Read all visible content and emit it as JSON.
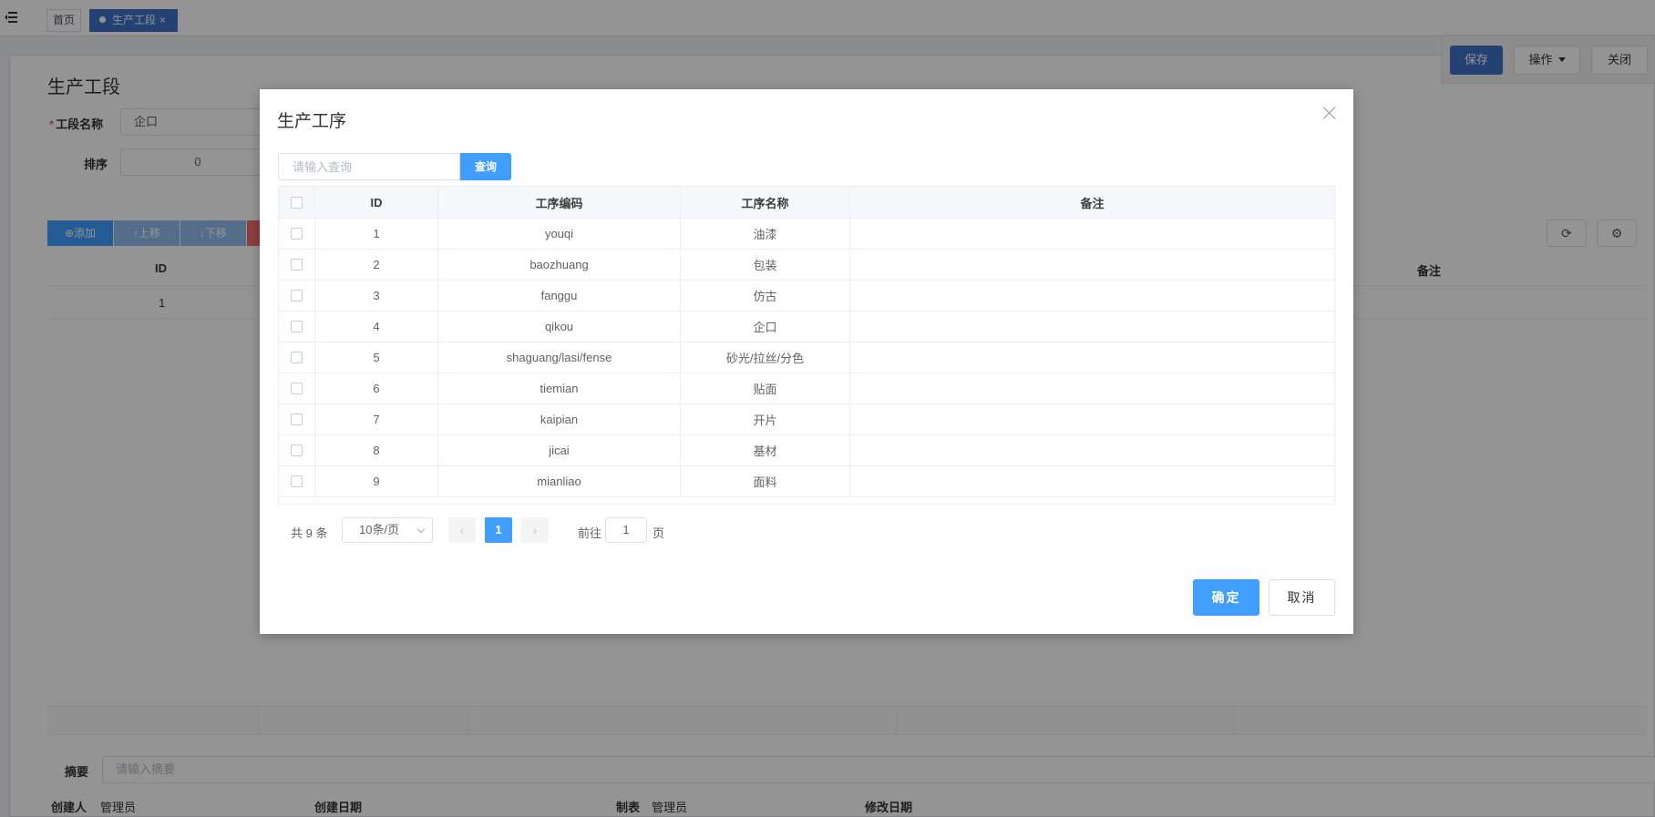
{
  "topbar": {
    "tabs": [
      {
        "label": "首页"
      },
      {
        "label": "生产工段",
        "close": "×"
      }
    ]
  },
  "page": {
    "title": "生产工段",
    "form": {
      "name_label": "工段名称",
      "name_value": "企口",
      "sort_label": "排序",
      "sort_value": "0"
    },
    "toolbar": {
      "add": "⊕添加",
      "up": "↑上移",
      "down": "↓下移"
    },
    "grid": {
      "col_id": "ID",
      "col_remark": "备注",
      "rows": [
        {
          "id": "1"
        }
      ]
    },
    "summary_label": "摘要",
    "summary_placeholder": "请输入摘要",
    "footer": {
      "creator_label": "创建人",
      "creator_value": "管理员",
      "created_label": "创建日期",
      "maker_label": "制表",
      "maker_value": "管理员",
      "modified_label": "修改日期"
    },
    "actions": {
      "save": "保存",
      "ops": "操作",
      "close": "关闭"
    }
  },
  "modal": {
    "title": "生产工序",
    "search_placeholder": "请输入查询",
    "search_button": "查询",
    "columns": {
      "id": "ID",
      "code": "工序编码",
      "name": "工序名称",
      "remark": "备注"
    },
    "rows": [
      {
        "id": "1",
        "code": "youqi",
        "name": "油漆",
        "remark": ""
      },
      {
        "id": "2",
        "code": "baozhuang",
        "name": "包装",
        "remark": ""
      },
      {
        "id": "3",
        "code": "fanggu",
        "name": "仿古",
        "remark": ""
      },
      {
        "id": "4",
        "code": "qikou",
        "name": "企口",
        "remark": ""
      },
      {
        "id": "5",
        "code": "shaguang/lasi/fense",
        "name": "砂光/拉丝/分色",
        "remark": ""
      },
      {
        "id": "6",
        "code": "tiemian",
        "name": "贴面",
        "remark": ""
      },
      {
        "id": "7",
        "code": "kaipian",
        "name": "开片",
        "remark": ""
      },
      {
        "id": "8",
        "code": "jicai",
        "name": "基材",
        "remark": ""
      },
      {
        "id": "9",
        "code": "mianliao",
        "name": "面料",
        "remark": ""
      }
    ],
    "pager": {
      "total": "共 9 条",
      "page_size": "10条/页",
      "prev": "‹",
      "current": "1",
      "next": "›",
      "goto_prefix": "前往",
      "goto_value": "1",
      "goto_suffix": "页"
    },
    "ok": "确定",
    "cancel": "取消"
  },
  "colors": {
    "primary": "#409eff",
    "tab_active": "#3e71c6",
    "danger": "#f56c6c"
  }
}
